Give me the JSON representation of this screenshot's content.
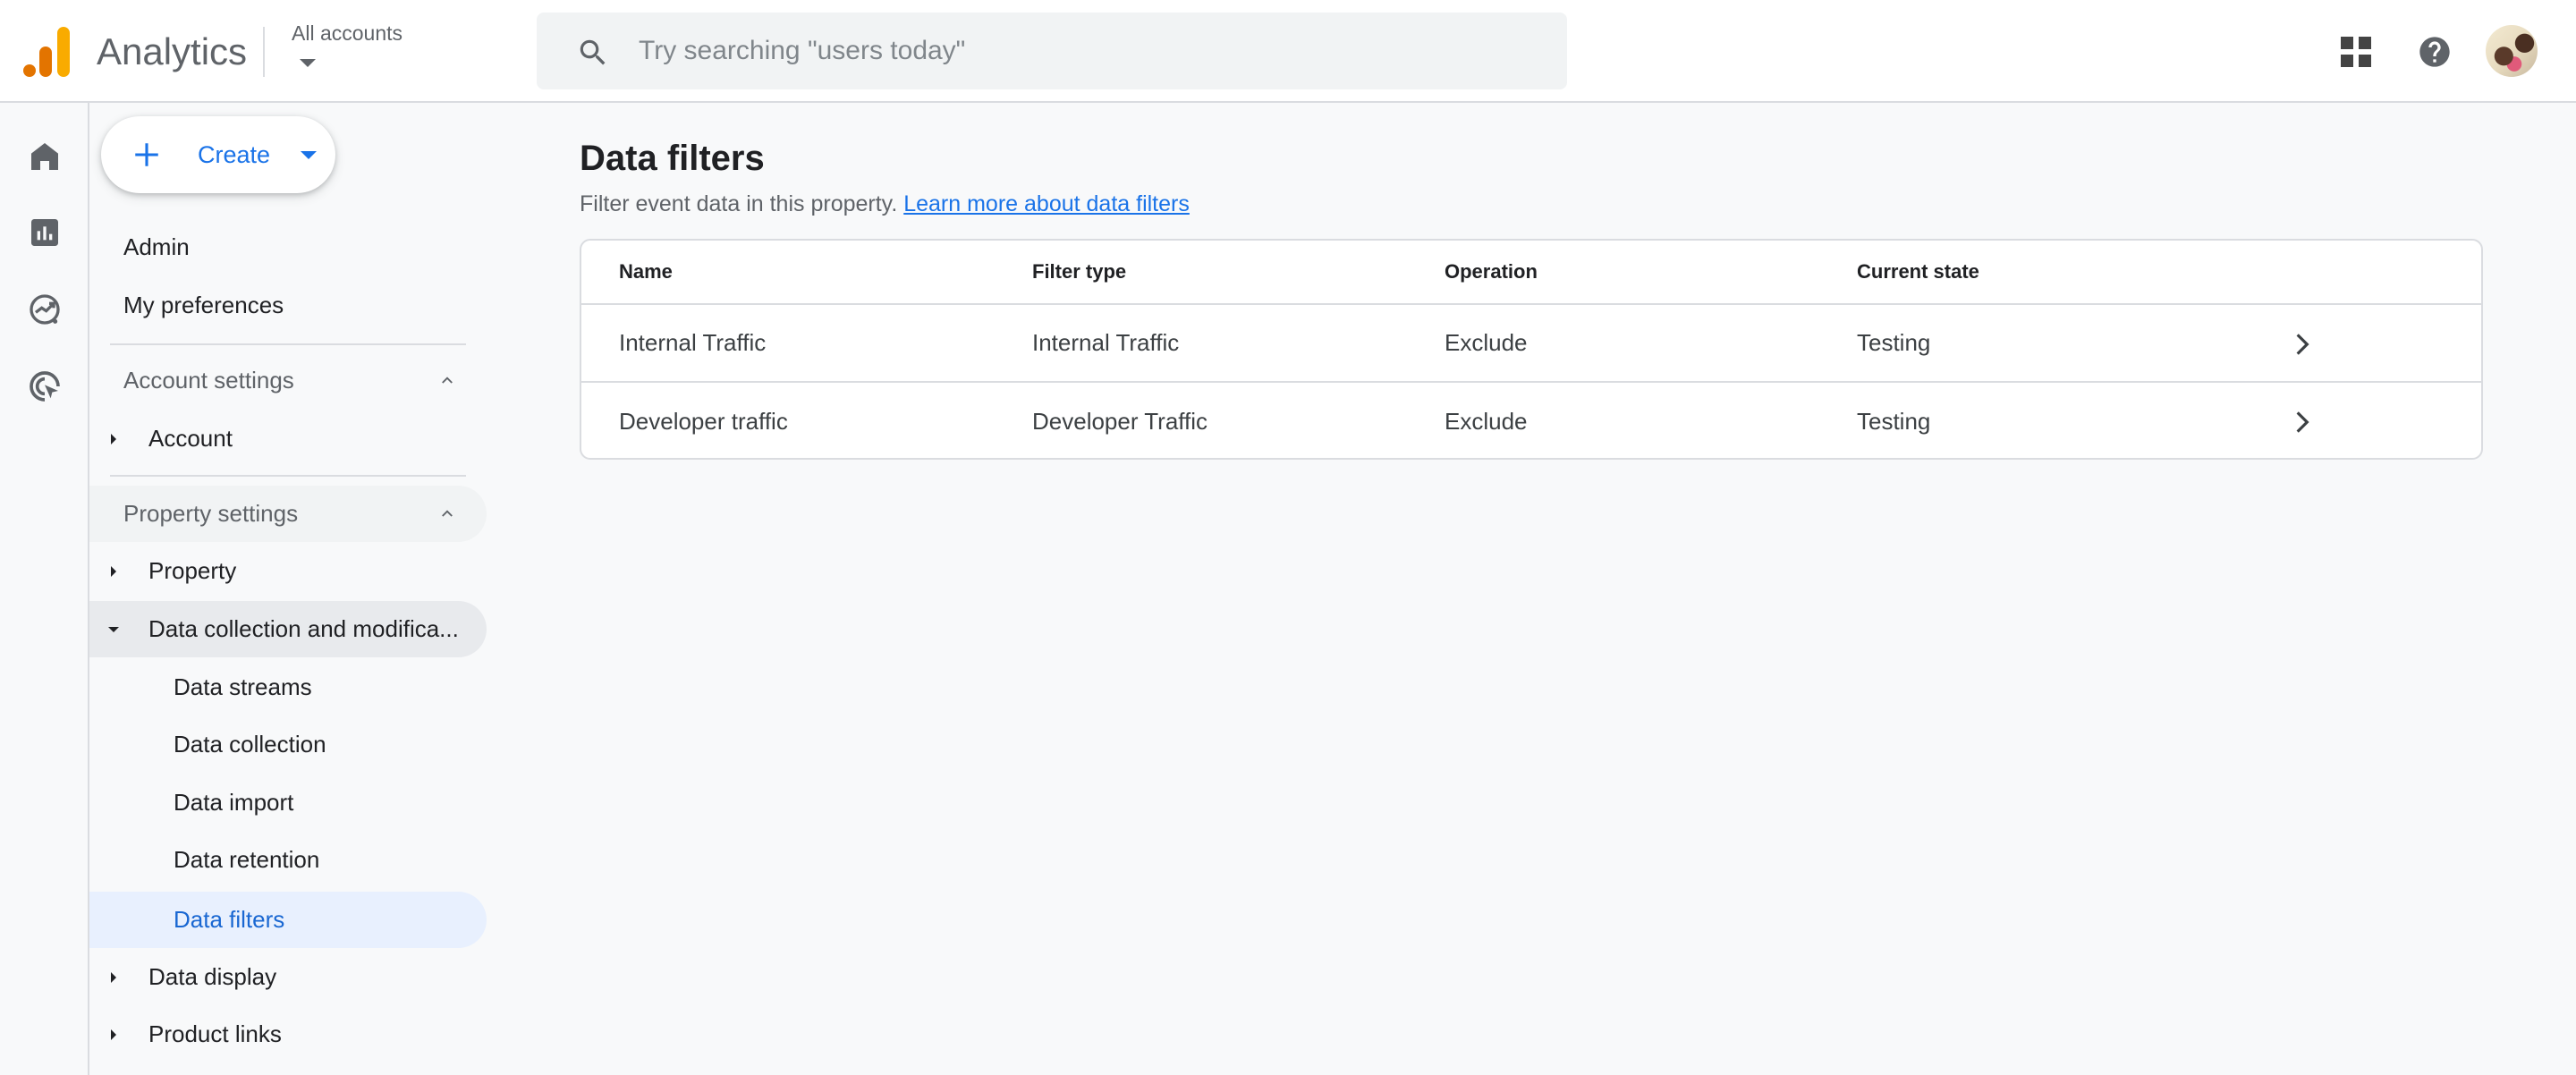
{
  "header": {
    "app_title": "Analytics",
    "account_picker_label": "All accounts",
    "search_placeholder": "Try searching \"users today\"",
    "search_value": "",
    "icons": {
      "apps": "apps-grid-icon",
      "help": "help-icon",
      "avatar": "account-avatar"
    }
  },
  "rail": {
    "items": [
      {
        "name": "home",
        "icon": "home-icon"
      },
      {
        "name": "reports",
        "icon": "bar-chart-icon"
      },
      {
        "name": "explore",
        "icon": "explore-trend-icon"
      },
      {
        "name": "advertising",
        "icon": "target-cursor-icon"
      }
    ]
  },
  "nav": {
    "create_label": "Create",
    "top_items": [
      "Admin",
      "My preferences"
    ],
    "account_settings": {
      "label": "Account settings",
      "items": [
        "Account"
      ]
    },
    "property_settings": {
      "label": "Property settings",
      "items": [
        {
          "label": "Property",
          "expanded": false
        },
        {
          "label": "Data collection and modification",
          "display": "Data collection and modifica...",
          "expanded": true,
          "children": [
            "Data streams",
            "Data collection",
            "Data import",
            "Data retention",
            "Data filters"
          ]
        },
        {
          "label": "Data display",
          "expanded": false
        },
        {
          "label": "Product links",
          "expanded": false
        }
      ],
      "active_item": "Data filters"
    }
  },
  "main": {
    "title": "Data filters",
    "subtitle": "Filter event data in this property.",
    "learn_more_link": "Learn more about data filters",
    "table": {
      "columns": [
        "Name",
        "Filter type",
        "Operation",
        "Current state"
      ],
      "rows": [
        {
          "name": "Internal Traffic",
          "filter_type": "Internal Traffic",
          "operation": "Exclude",
          "state": "Testing"
        },
        {
          "name": "Developer traffic",
          "filter_type": "Developer Traffic",
          "operation": "Exclude",
          "state": "Testing"
        }
      ]
    }
  },
  "colors": {
    "accent": "#1a73e8",
    "active_nav_bg": "#e8f0fe",
    "logo_orange": "#e37400",
    "logo_yellow": "#f9ab00"
  }
}
